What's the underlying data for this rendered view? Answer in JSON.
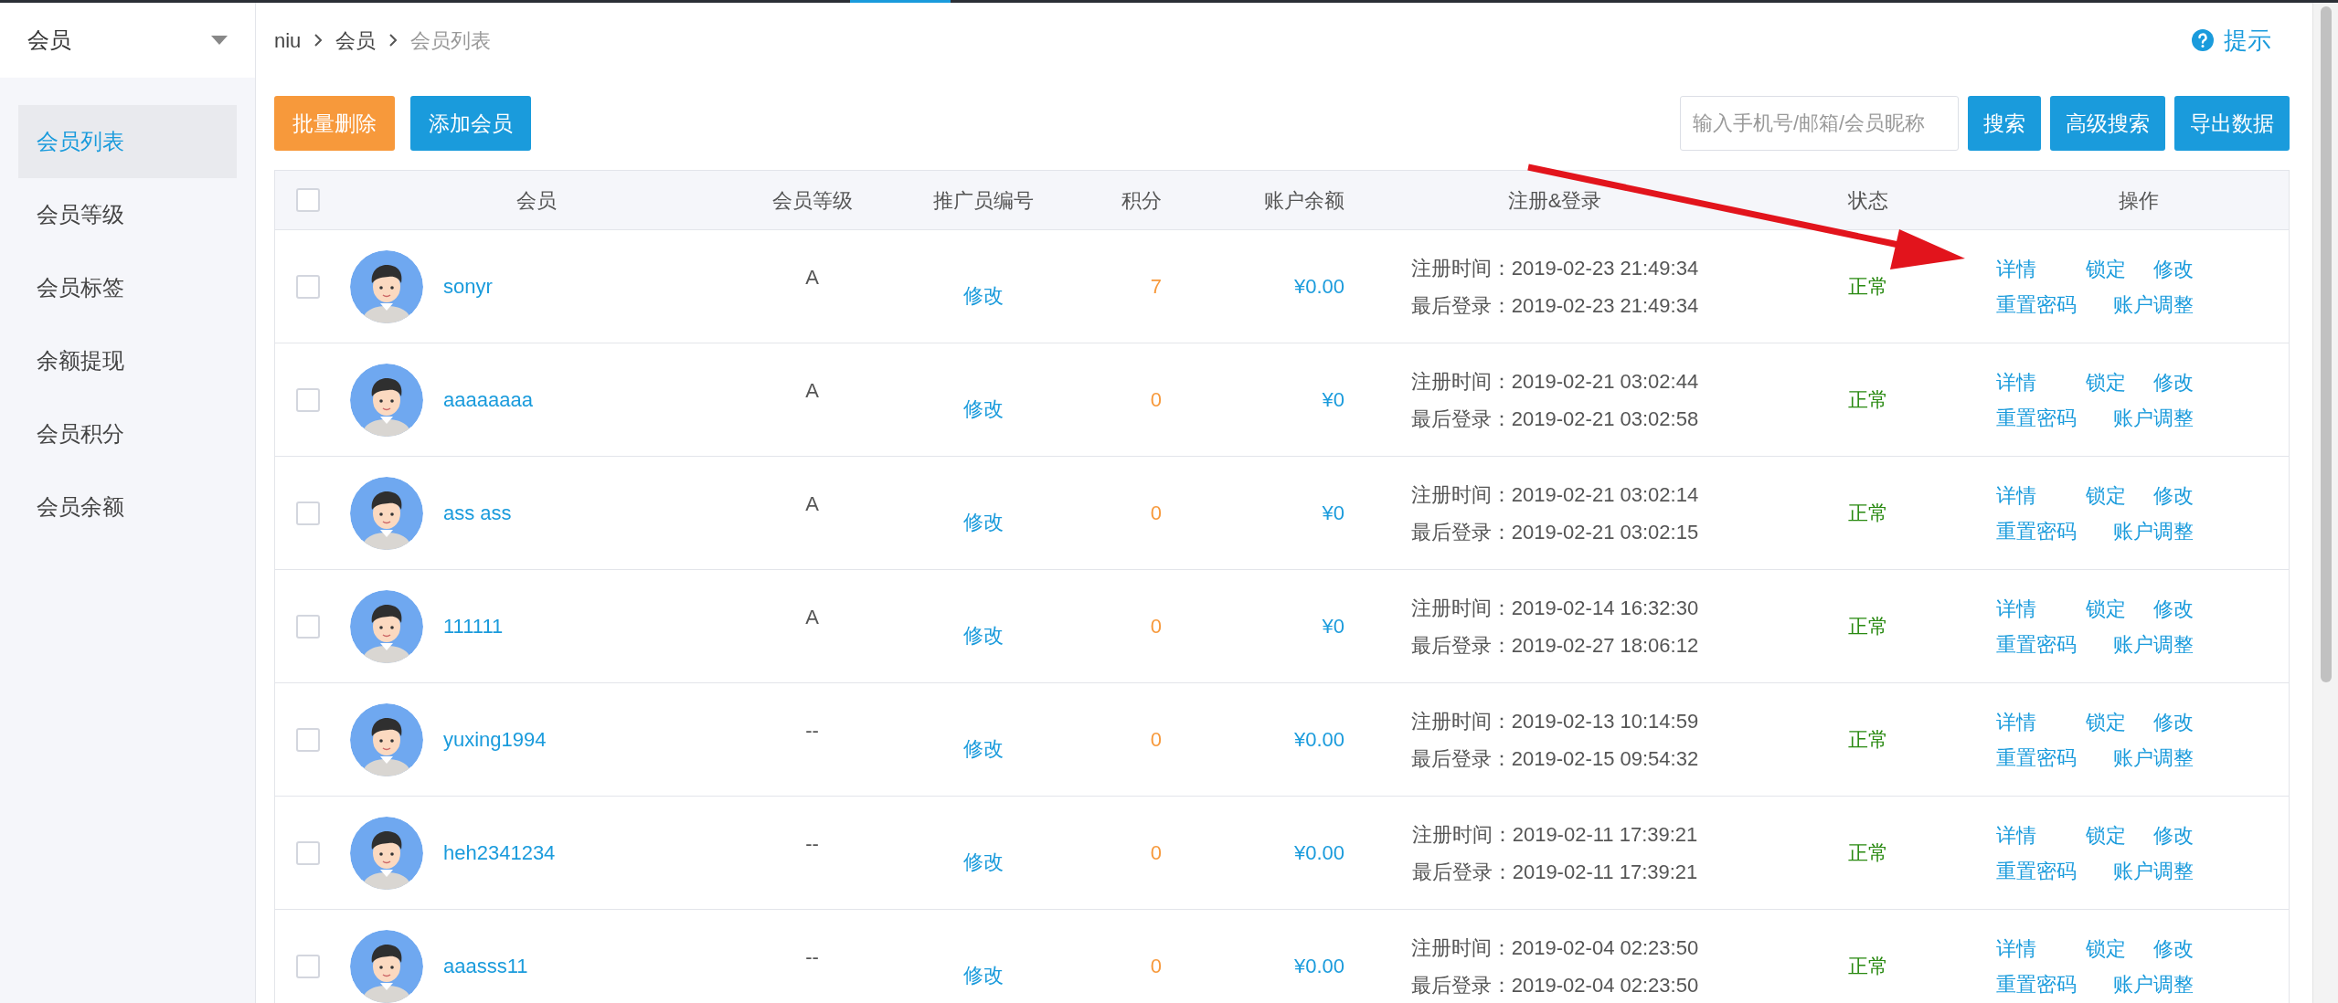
{
  "sidebar": {
    "header": "会员",
    "items": [
      {
        "label": "会员列表",
        "selected": true
      },
      {
        "label": "会员等级",
        "selected": false
      },
      {
        "label": "会员标签",
        "selected": false
      },
      {
        "label": "余额提现",
        "selected": false
      },
      {
        "label": "会员积分",
        "selected": false
      },
      {
        "label": "会员余额",
        "selected": false
      }
    ]
  },
  "breadcrumb": [
    "niu",
    "会员",
    "会员列表"
  ],
  "help_link": "提示",
  "toolbar": {
    "left_buttons": [
      {
        "label": "批量删除",
        "kind": "warning"
      },
      {
        "label": "添加会员",
        "kind": "primary"
      }
    ],
    "search": {
      "placeholder": "输入手机号/邮箱/会员昵称"
    },
    "right_buttons": [
      "搜索",
      "高级搜索",
      "导出数据"
    ]
  },
  "table": {
    "select_all_checked": false,
    "columns": [
      "会员",
      "会员等级",
      "推广员编号",
      "积分",
      "账户余额",
      "注册&登录",
      "状态",
      "操作"
    ],
    "rows": [
      {
        "checked": false,
        "member": "sonyr",
        "level": "A",
        "referrer_action": "修改",
        "points": "7",
        "balance": "¥0.00",
        "registered": "注册时间：2019-02-23 21:49:34",
        "last_login": "最后登录：2019-02-23 21:49:34",
        "status": "正常",
        "actions": [
          "详情",
          "锁定",
          "修改",
          "重置密码",
          "账户调整"
        ]
      },
      {
        "checked": false,
        "member": "aaaaaaaa",
        "level": "A",
        "referrer_action": "修改",
        "points": "0",
        "balance": "¥0",
        "registered": "注册时间：2019-02-21 03:02:44",
        "last_login": "最后登录：2019-02-21 03:02:58",
        "status": "正常",
        "actions": [
          "详情",
          "锁定",
          "修改",
          "重置密码",
          "账户调整"
        ]
      },
      {
        "checked": false,
        "member": "ass ass",
        "level": "A",
        "referrer_action": "修改",
        "points": "0",
        "balance": "¥0",
        "registered": "注册时间：2019-02-21 03:02:14",
        "last_login": "最后登录：2019-02-21 03:02:15",
        "status": "正常",
        "actions": [
          "详情",
          "锁定",
          "修改",
          "重置密码",
          "账户调整"
        ]
      },
      {
        "checked": false,
        "member": "111111",
        "level": "A",
        "referrer_action": "修改",
        "points": "0",
        "balance": "¥0",
        "registered": "注册时间：2019-02-14 16:32:30",
        "last_login": "最后登录：2019-02-27 18:06:12",
        "status": "正常",
        "actions": [
          "详情",
          "锁定",
          "修改",
          "重置密码",
          "账户调整"
        ]
      },
      {
        "checked": false,
        "member": "yuxing1994",
        "level": "--",
        "referrer_action": "修改",
        "points": "0",
        "balance": "¥0.00",
        "registered": "注册时间：2019-02-13 10:14:59",
        "last_login": "最后登录：2019-02-15 09:54:32",
        "status": "正常",
        "actions": [
          "详情",
          "锁定",
          "修改",
          "重置密码",
          "账户调整"
        ]
      },
      {
        "checked": false,
        "member": "heh2341234",
        "level": "--",
        "referrer_action": "修改",
        "points": "0",
        "balance": "¥0.00",
        "registered": "注册时间：2019-02-11 17:39:21",
        "last_login": "最后登录：2019-02-11 17:39:21",
        "status": "正常",
        "actions": [
          "详情",
          "锁定",
          "修改",
          "重置密码",
          "账户调整"
        ]
      },
      {
        "checked": false,
        "member": "aaasss11",
        "level": "--",
        "referrer_action": "修改",
        "points": "0",
        "balance": "¥0.00",
        "registered": "注册时间：2019-02-04 02:23:50",
        "last_login": "最后登录：2019-02-04 02:23:50",
        "status": "正常",
        "actions": [
          "详情",
          "锁定",
          "修改",
          "重置密码",
          "账户调整"
        ]
      }
    ]
  }
}
